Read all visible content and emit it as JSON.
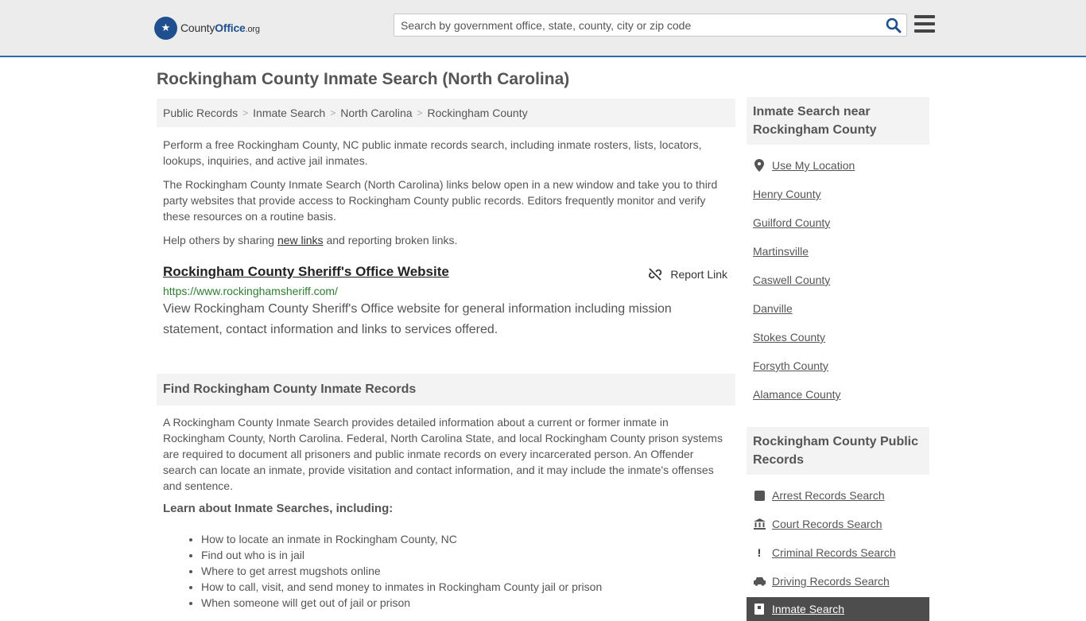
{
  "header": {
    "logo_name": "County",
    "logo_bold": "Office",
    "logo_tld": ".org",
    "search_placeholder": "Search by government office, state, county, city or zip code"
  },
  "page_title": "Rockingham County Inmate Search (North Carolina)",
  "breadcrumb": [
    "Public Records",
    "Inmate Search",
    "North Carolina",
    "Rockingham County"
  ],
  "intro": {
    "p1": "Perform a free Rockingham County, NC public inmate records search, including inmate rosters, lists, locators, lookups, inquiries, and active jail inmates.",
    "p2": "The Rockingham County Inmate Search (North Carolina) links below open in a new window and take you to third party websites that provide access to Rockingham County public records. Editors frequently monitor and verify these resources on a routine basis.",
    "p3_before": "Help others by sharing ",
    "p3_link": "new links",
    "p3_after": " and reporting broken links."
  },
  "listing": {
    "title": "Rockingham County Sheriff's Office Website",
    "report_label": "Report Link",
    "url": "https://www.rockinghamsheriff.com/",
    "description": "View Rockingham County Sheriff's Office website for general information including mission statement, contact information and links to services offered."
  },
  "find_section": {
    "heading": "Find Rockingham County Inmate Records",
    "body": "A Rockingham County Inmate Search provides detailed information about a current or former inmate in Rockingham County, North Carolina. Federal, North Carolina State, and local Rockingham County prison systems are required to document all prisoners and public inmate records on every incarcerated person. An Offender search can locate an inmate, provide visitation and contact information, and it may include the inmate's offenses and sentence.",
    "subheading": "Learn about Inmate Searches, including:",
    "points": [
      "How to locate an inmate in Rockingham County, NC",
      "Find out who is in jail",
      "Where to get arrest mugshots online",
      "How to call, visit, and send money to inmates in Rockingham County jail or prison",
      "When someone will get out of jail or prison"
    ]
  },
  "sidebar": {
    "nearby_heading": "Inmate Search near Rockingham County",
    "use_location": "Use My Location",
    "nearby": [
      "Henry County",
      "Guilford County",
      "Martinsville",
      "Caswell County",
      "Danville",
      "Stokes County",
      "Forsyth County",
      "Alamance County"
    ],
    "records_heading": "Rockingham County Public Records",
    "records": [
      {
        "label": "Arrest Records Search",
        "icon": "square-icon"
      },
      {
        "label": "Court Records Search",
        "icon": "courthouse-icon"
      },
      {
        "label": "Criminal Records Search",
        "icon": "exclamation-icon"
      },
      {
        "label": "Driving Records Search",
        "icon": "car-icon"
      }
    ],
    "active_record": "Inmate Search"
  },
  "colors": {
    "brand_blue": "#1f4f8f",
    "url_green": "#2e7d32",
    "header_bg": "#ececec",
    "active_bg": "#4d4d4d"
  }
}
